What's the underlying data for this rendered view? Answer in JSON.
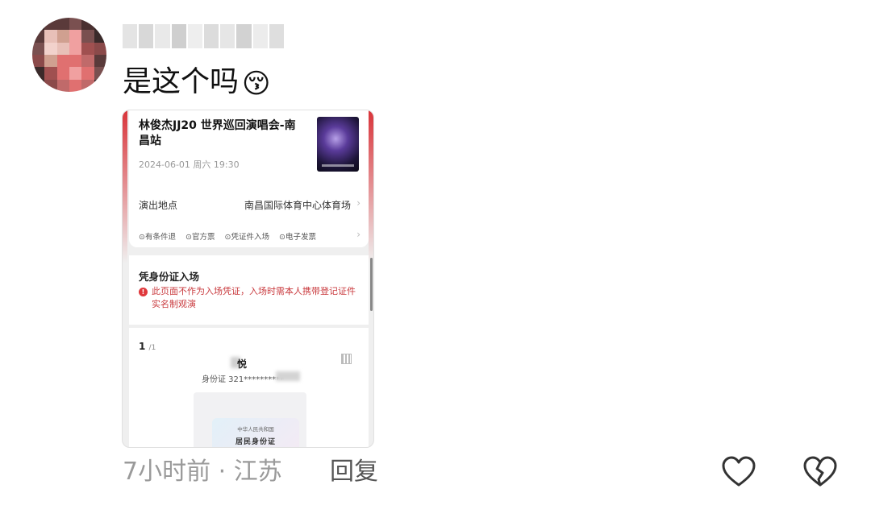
{
  "comment": {
    "text": "是这个吗",
    "emoji": "😚",
    "time_location": "7小时前 · 江苏",
    "reply_label": "回复",
    "like_icon": "heart-outline-icon",
    "dislike_icon": "broken-heart-icon"
  },
  "screenshot": {
    "event_title": "林俊杰JJ20 世界巡回演唱会-南昌站",
    "event_datetime": "2024-06-01 周六 19:30",
    "venue_label": "演出地点",
    "venue_value": "南昌国际体育中心体育场",
    "chevron": "›",
    "tags": [
      "⊙有条件退",
      "⊙官方票",
      "⊙凭证件入场",
      "⊙电子发票"
    ],
    "id_entry_title": "凭身份证入场",
    "warning_icon": "!",
    "warning_text": "此页面不作为入场凭证，入场时需本人携带登记证件实名制观演",
    "ticket_index": "1",
    "ticket_total": "/1",
    "holder_name": "悦",
    "id_number": "身份证 321**********",
    "id_card_line1": "中华人民共和国",
    "id_card_line2": "居民身份证"
  },
  "colors": {
    "accent_red": "#d9343a",
    "warning_red": "#c93a3e",
    "meta_gray": "#9a9a9a"
  }
}
